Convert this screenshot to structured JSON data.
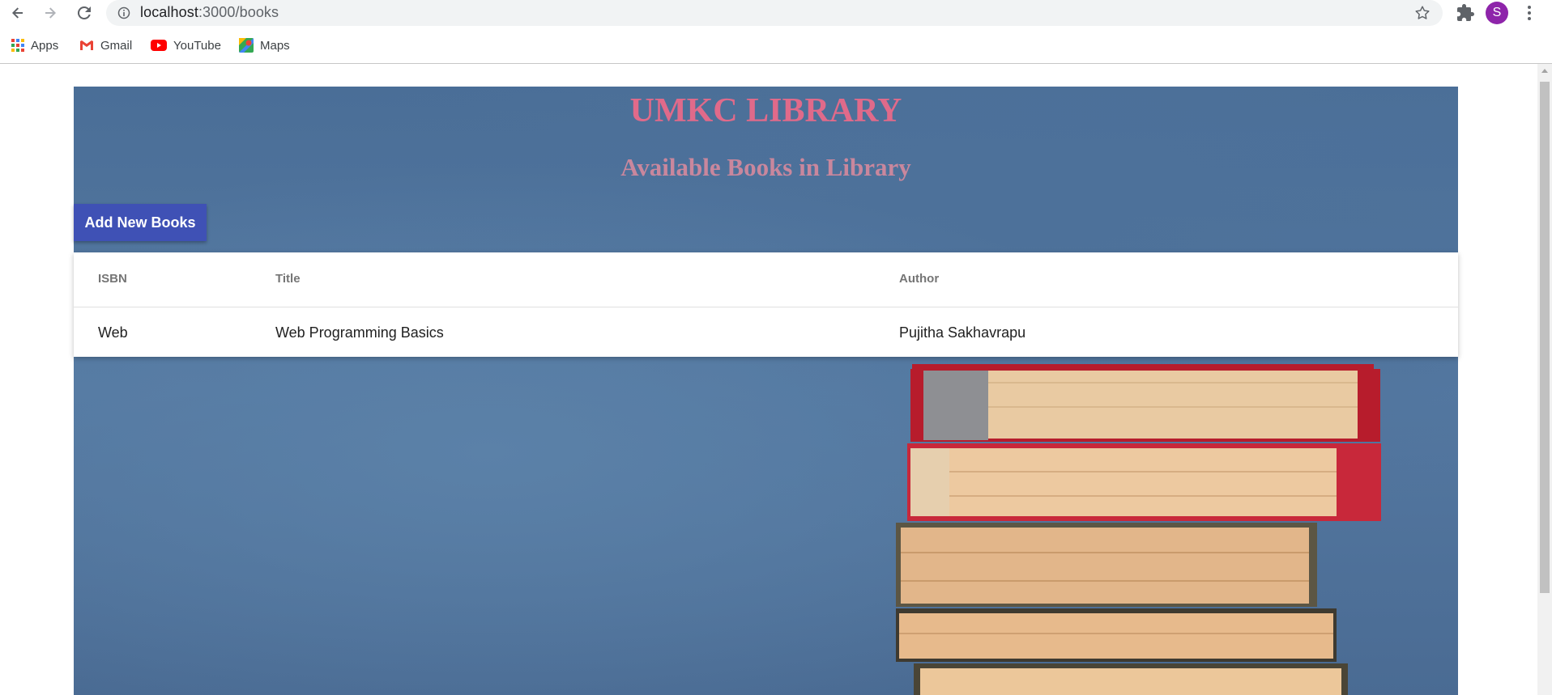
{
  "browser": {
    "url_host": "localhost",
    "url_path": ":3000/books",
    "avatar_letter": "S",
    "bookmarks": [
      {
        "label": "Apps",
        "icon": "apps-grid-icon"
      },
      {
        "label": "Gmail",
        "icon": "gmail-icon"
      },
      {
        "label": "YouTube",
        "icon": "youtube-icon"
      },
      {
        "label": "Maps",
        "icon": "maps-icon"
      }
    ]
  },
  "page": {
    "title": "UMKC LIBRARY",
    "subtitle": "Available Books in Library",
    "add_button_label": "Add New Books",
    "title_color": "#e06a8a",
    "subtitle_color": "#c9879d",
    "button_color": "#3f51b5"
  },
  "table": {
    "columns": [
      "ISBN",
      "Title",
      "Author"
    ],
    "rows": [
      [
        "Web",
        "Web Programming Basics",
        "Pujitha Sakhavrapu"
      ]
    ]
  }
}
